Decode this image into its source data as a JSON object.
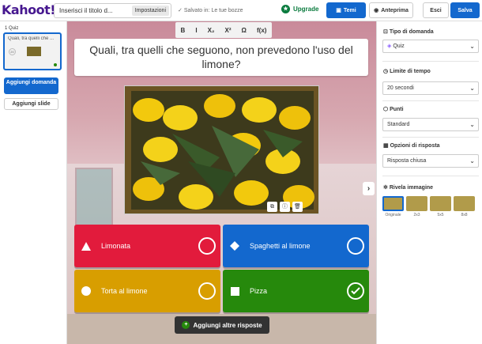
{
  "header": {
    "logo": "Kahoot!",
    "title_placeholder": "Inserisci il titolo d...",
    "settings": "Impostazioni",
    "saved": "Salvato in: Le tue bozze",
    "upgrade": "Upgrade",
    "themes": "Temi",
    "preview": "Anteprima",
    "exit": "Esci",
    "save": "Salva"
  },
  "sidebar": {
    "slide_number": "1  Quiz",
    "slide_text": "Quali, tra quelli che ...",
    "timer": "20",
    "add_question": "Aggiungi domanda",
    "add_slide": "Aggiungi slide"
  },
  "editor": {
    "toolbar": [
      "B",
      "I",
      "X₂",
      "X²",
      "Ω",
      "f(x)"
    ],
    "question": "Quali, tra quelli che seguono, non prevedono l'uso del limone?",
    "answers": [
      {
        "label": "Limonata",
        "shape": "triangle",
        "correct": false
      },
      {
        "label": "Spaghetti al limone",
        "shape": "diamond",
        "correct": false
      },
      {
        "label": "Torta al limone",
        "shape": "circle",
        "correct": false
      },
      {
        "label": "Pizza",
        "shape": "square",
        "correct": true
      }
    ],
    "add_more": "Aggiungi altre risposte"
  },
  "settings_panel": {
    "question_type_label": "Tipo di domanda",
    "question_type_value": "Quiz",
    "time_limit_label": "Limite di tempo",
    "time_limit_value": "20 secondi",
    "points_label": "Punti",
    "points_value": "Standard",
    "answer_options_label": "Opzioni di risposta",
    "answer_options_value": "Risposta chiusa",
    "reveal_label": "Rivela immagine",
    "reveal_options": [
      "Originale",
      "2x3",
      "5x5",
      "8x8"
    ]
  },
  "colors": {
    "brand": "#46178f",
    "primary": "#1368ce",
    "red": "#e21b3c",
    "blue": "#1368ce",
    "yellow": "#d89e00",
    "green": "#26890c"
  }
}
